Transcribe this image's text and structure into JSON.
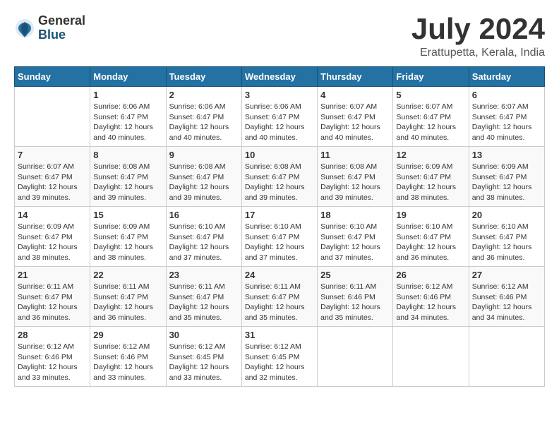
{
  "logo": {
    "general": "General",
    "blue": "Blue"
  },
  "title": "July 2024",
  "location": "Erattupetta, Kerala, India",
  "days_of_week": [
    "Sunday",
    "Monday",
    "Tuesday",
    "Wednesday",
    "Thursday",
    "Friday",
    "Saturday"
  ],
  "weeks": [
    [
      {
        "day": "",
        "info": ""
      },
      {
        "day": "1",
        "info": "Sunrise: 6:06 AM\nSunset: 6:47 PM\nDaylight: 12 hours\nand 40 minutes."
      },
      {
        "day": "2",
        "info": "Sunrise: 6:06 AM\nSunset: 6:47 PM\nDaylight: 12 hours\nand 40 minutes."
      },
      {
        "day": "3",
        "info": "Sunrise: 6:06 AM\nSunset: 6:47 PM\nDaylight: 12 hours\nand 40 minutes."
      },
      {
        "day": "4",
        "info": "Sunrise: 6:07 AM\nSunset: 6:47 PM\nDaylight: 12 hours\nand 40 minutes."
      },
      {
        "day": "5",
        "info": "Sunrise: 6:07 AM\nSunset: 6:47 PM\nDaylight: 12 hours\nand 40 minutes."
      },
      {
        "day": "6",
        "info": "Sunrise: 6:07 AM\nSunset: 6:47 PM\nDaylight: 12 hours\nand 40 minutes."
      }
    ],
    [
      {
        "day": "7",
        "info": "Sunrise: 6:07 AM\nSunset: 6:47 PM\nDaylight: 12 hours\nand 39 minutes."
      },
      {
        "day": "8",
        "info": "Sunrise: 6:08 AM\nSunset: 6:47 PM\nDaylight: 12 hours\nand 39 minutes."
      },
      {
        "day": "9",
        "info": "Sunrise: 6:08 AM\nSunset: 6:47 PM\nDaylight: 12 hours\nand 39 minutes."
      },
      {
        "day": "10",
        "info": "Sunrise: 6:08 AM\nSunset: 6:47 PM\nDaylight: 12 hours\nand 39 minutes."
      },
      {
        "day": "11",
        "info": "Sunrise: 6:08 AM\nSunset: 6:47 PM\nDaylight: 12 hours\nand 39 minutes."
      },
      {
        "day": "12",
        "info": "Sunrise: 6:09 AM\nSunset: 6:47 PM\nDaylight: 12 hours\nand 38 minutes."
      },
      {
        "day": "13",
        "info": "Sunrise: 6:09 AM\nSunset: 6:47 PM\nDaylight: 12 hours\nand 38 minutes."
      }
    ],
    [
      {
        "day": "14",
        "info": "Sunrise: 6:09 AM\nSunset: 6:47 PM\nDaylight: 12 hours\nand 38 minutes."
      },
      {
        "day": "15",
        "info": "Sunrise: 6:09 AM\nSunset: 6:47 PM\nDaylight: 12 hours\nand 38 minutes."
      },
      {
        "day": "16",
        "info": "Sunrise: 6:10 AM\nSunset: 6:47 PM\nDaylight: 12 hours\nand 37 minutes."
      },
      {
        "day": "17",
        "info": "Sunrise: 6:10 AM\nSunset: 6:47 PM\nDaylight: 12 hours\nand 37 minutes."
      },
      {
        "day": "18",
        "info": "Sunrise: 6:10 AM\nSunset: 6:47 PM\nDaylight: 12 hours\nand 37 minutes."
      },
      {
        "day": "19",
        "info": "Sunrise: 6:10 AM\nSunset: 6:47 PM\nDaylight: 12 hours\nand 36 minutes."
      },
      {
        "day": "20",
        "info": "Sunrise: 6:10 AM\nSunset: 6:47 PM\nDaylight: 12 hours\nand 36 minutes."
      }
    ],
    [
      {
        "day": "21",
        "info": "Sunrise: 6:11 AM\nSunset: 6:47 PM\nDaylight: 12 hours\nand 36 minutes."
      },
      {
        "day": "22",
        "info": "Sunrise: 6:11 AM\nSunset: 6:47 PM\nDaylight: 12 hours\nand 36 minutes."
      },
      {
        "day": "23",
        "info": "Sunrise: 6:11 AM\nSunset: 6:47 PM\nDaylight: 12 hours\nand 35 minutes."
      },
      {
        "day": "24",
        "info": "Sunrise: 6:11 AM\nSunset: 6:47 PM\nDaylight: 12 hours\nand 35 minutes."
      },
      {
        "day": "25",
        "info": "Sunrise: 6:11 AM\nSunset: 6:46 PM\nDaylight: 12 hours\nand 35 minutes."
      },
      {
        "day": "26",
        "info": "Sunrise: 6:12 AM\nSunset: 6:46 PM\nDaylight: 12 hours\nand 34 minutes."
      },
      {
        "day": "27",
        "info": "Sunrise: 6:12 AM\nSunset: 6:46 PM\nDaylight: 12 hours\nand 34 minutes."
      }
    ],
    [
      {
        "day": "28",
        "info": "Sunrise: 6:12 AM\nSunset: 6:46 PM\nDaylight: 12 hours\nand 33 minutes."
      },
      {
        "day": "29",
        "info": "Sunrise: 6:12 AM\nSunset: 6:46 PM\nDaylight: 12 hours\nand 33 minutes."
      },
      {
        "day": "30",
        "info": "Sunrise: 6:12 AM\nSunset: 6:45 PM\nDaylight: 12 hours\nand 33 minutes."
      },
      {
        "day": "31",
        "info": "Sunrise: 6:12 AM\nSunset: 6:45 PM\nDaylight: 12 hours\nand 32 minutes."
      },
      {
        "day": "",
        "info": ""
      },
      {
        "day": "",
        "info": ""
      },
      {
        "day": "",
        "info": ""
      }
    ]
  ]
}
